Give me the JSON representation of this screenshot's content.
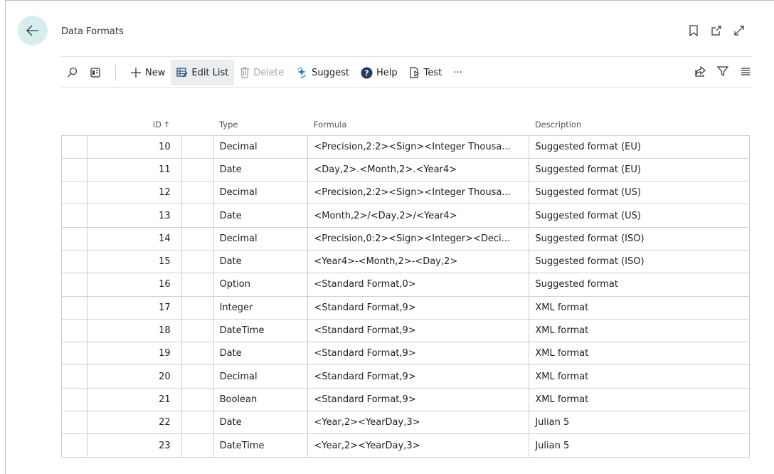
{
  "page": {
    "title": "Data Formats"
  },
  "toolbar": {
    "new_label": "New",
    "edit_list_label": "Edit List",
    "delete_label": "Delete",
    "suggest_label": "Suggest",
    "help_label": "Help",
    "test_label": "Test",
    "more_label": "···"
  },
  "table": {
    "headers": {
      "id": "ID",
      "id_sort": "↑",
      "type": "Type",
      "formula": "Formula",
      "description": "Description"
    },
    "rows": [
      {
        "id": "10",
        "type": "Decimal",
        "formula": "<Precision,2:2><Sign><Integer Thousa...",
        "description": "Suggested format (EU)"
      },
      {
        "id": "11",
        "type": "Date",
        "formula": "<Day,2>.<Month,2>.<Year4>",
        "description": "Suggested format (EU)"
      },
      {
        "id": "12",
        "type": "Decimal",
        "formula": "<Precision,2:2><Sign><Integer Thousa...",
        "description": "Suggested format (US)"
      },
      {
        "id": "13",
        "type": "Date",
        "formula": "<Month,2>/<Day,2>/<Year4>",
        "description": "Suggested format (US)"
      },
      {
        "id": "14",
        "type": "Decimal",
        "formula": "<Precision,0:2><Sign><Integer><Deci...",
        "description": "Suggested format (ISO)"
      },
      {
        "id": "15",
        "type": "Date",
        "formula": "<Year4>-<Month,2>-<Day,2>",
        "description": "Suggested format (ISO)"
      },
      {
        "id": "16",
        "type": "Option",
        "formula": "<Standard Format,0>",
        "description": "Suggested format"
      },
      {
        "id": "17",
        "type": "Integer",
        "formula": "<Standard Format,9>",
        "description": "XML format"
      },
      {
        "id": "18",
        "type": "DateTime",
        "formula": "<Standard Format,9>",
        "description": "XML format"
      },
      {
        "id": "19",
        "type": "Date",
        "formula": "<Standard Format,9>",
        "description": "XML format"
      },
      {
        "id": "20",
        "type": "Decimal",
        "formula": "<Standard Format,9>",
        "description": "XML format"
      },
      {
        "id": "21",
        "type": "Boolean",
        "formula": "<Standard Format,9>",
        "description": "XML format"
      },
      {
        "id": "22",
        "type": "Date",
        "formula": "<Year,2><YearDay,3>",
        "description": "Julian 5"
      },
      {
        "id": "23",
        "type": "DateTime",
        "formula": "<Year,2><YearDay,3>",
        "description": "Julian 5"
      }
    ]
  },
  "colors": {
    "back_button_bg": "#d7eef1",
    "edit_list_icon": "#2e5f8a",
    "suggest_icon": "#2e7ac9",
    "help_icon": "#1f3b5a"
  }
}
